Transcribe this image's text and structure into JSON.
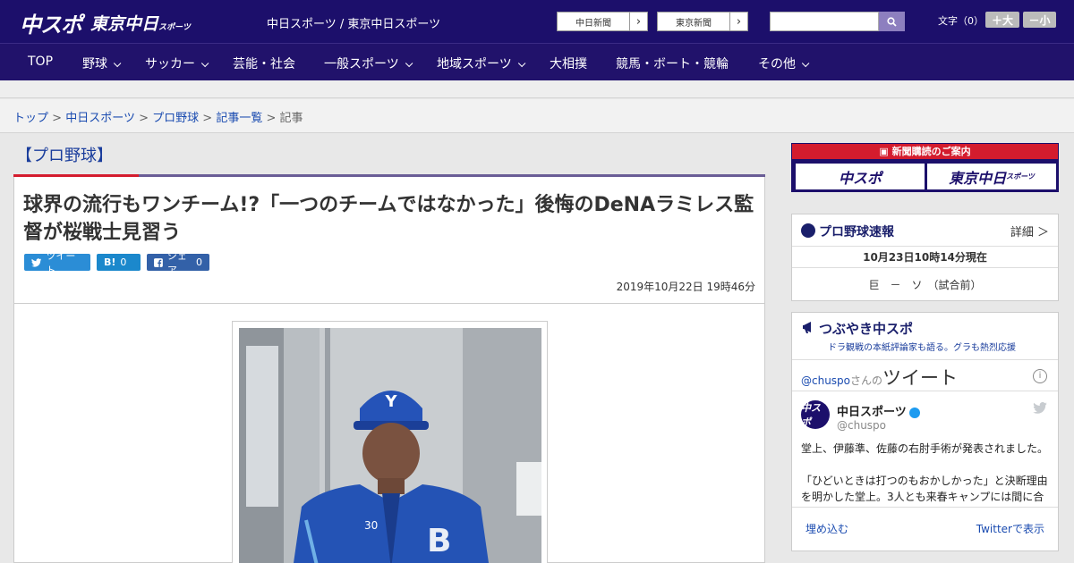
{
  "header": {
    "logo_chuspo": "中スポ",
    "logo_tokyo": "東京中日",
    "logo_tokyo_small": "スポーツ",
    "site_links": "中日スポーツ / 東京中日スポーツ",
    "paper_links": [
      {
        "label": "中日新聞",
        "arrow": "›"
      },
      {
        "label": "東京新聞",
        "arrow": "›"
      }
    ],
    "search_placeholder": "",
    "font_size_label": "文字（0）",
    "font_plus": "＋大",
    "font_minus": "－小"
  },
  "nav": [
    {
      "label": "TOP",
      "dropdown": false
    },
    {
      "label": "野球",
      "dropdown": true
    },
    {
      "label": "サッカー",
      "dropdown": true
    },
    {
      "label": "芸能・社会",
      "dropdown": false
    },
    {
      "label": "一般スポーツ",
      "dropdown": true
    },
    {
      "label": "地域スポーツ",
      "dropdown": true
    },
    {
      "label": "大相撲",
      "dropdown": false
    },
    {
      "label": "競馬・ボート・競輪",
      "dropdown": false
    },
    {
      "label": "その他",
      "dropdown": true
    }
  ],
  "breadcrumb": {
    "items": [
      "トップ",
      "中日スポーツ",
      "プロ野球",
      "記事一覧"
    ],
    "current": "記事",
    "separator": ">"
  },
  "article": {
    "category": "【プロ野球】",
    "headline": "球界の流行もワンチーム!?「一つのチームではなかった」後悔のDeNAラミレス監督が桜戦士見習う",
    "share": {
      "tweet": "ツイート",
      "hatena_icon": "B!",
      "hatena_count": "0",
      "facebook": "シェア",
      "facebook_count": "0"
    },
    "date": "2019年10月22日 19時46分"
  },
  "sidebar": {
    "promo_title": "新聞購読のご案内",
    "promo_chuspo": "中スポ",
    "promo_tokyo": "東京中日",
    "promo_tokyo_small": "スポーツ",
    "scores": {
      "title": "プロ野球速報",
      "detail": "詳細 ＞",
      "time": "10月23日10時14分現在",
      "game": "巨　－　ソ　（試合前）"
    },
    "twitter": {
      "title": "つぶやき中スポ",
      "subtitle": "ドラ観戦の本紙評論家も語る。グラも熱烈応援",
      "handle_prefix": "@chuspo",
      "handle_san": "さんの",
      "handle_tweet": "ツイート",
      "account_name": "中日スポーツ",
      "account_user": "@chuspo",
      "avatar_text": "中スポ",
      "tweet_line1": "堂上、伊藤準、佐藤の右肘手術が発表されました。",
      "tweet_line2": "「ひどいときは打つのもおかしかった」と決断理由を明かした堂上。3人とも来春キャンプには間に合",
      "embed": "埋め込む",
      "view_on_twitter": "Twitterで表示"
    }
  },
  "colors": {
    "header_bg": "#1c0f6b",
    "nav_bg": "#21126b",
    "accent_red": "#d41c2e",
    "link_blue": "#1a4bb0"
  }
}
